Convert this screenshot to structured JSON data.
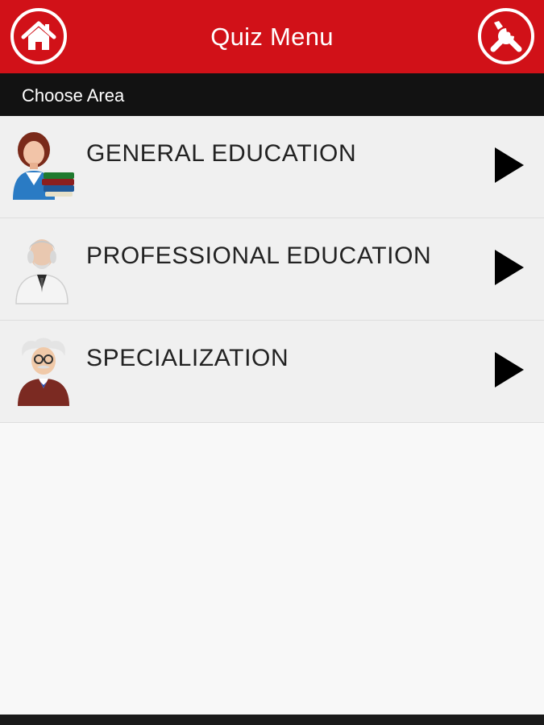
{
  "header": {
    "title": "Quiz Menu",
    "home_icon": "home-icon",
    "settings_icon": "tools-icon"
  },
  "subheader": {
    "label": "Choose Area"
  },
  "menu": {
    "items": [
      {
        "label": "GENERAL EDUCATION",
        "icon": "female-teacher-with-books-icon"
      },
      {
        "label": "PROFESSIONAL EDUCATION",
        "icon": "elderly-professor-icon"
      },
      {
        "label": "SPECIALIZATION",
        "icon": "scientist-with-glasses-icon"
      }
    ]
  },
  "colors": {
    "header_bg": "#d11118",
    "subheader_bg": "#121212",
    "list_bg": "#f0f0f0",
    "page_bg": "#f8f8f8"
  }
}
